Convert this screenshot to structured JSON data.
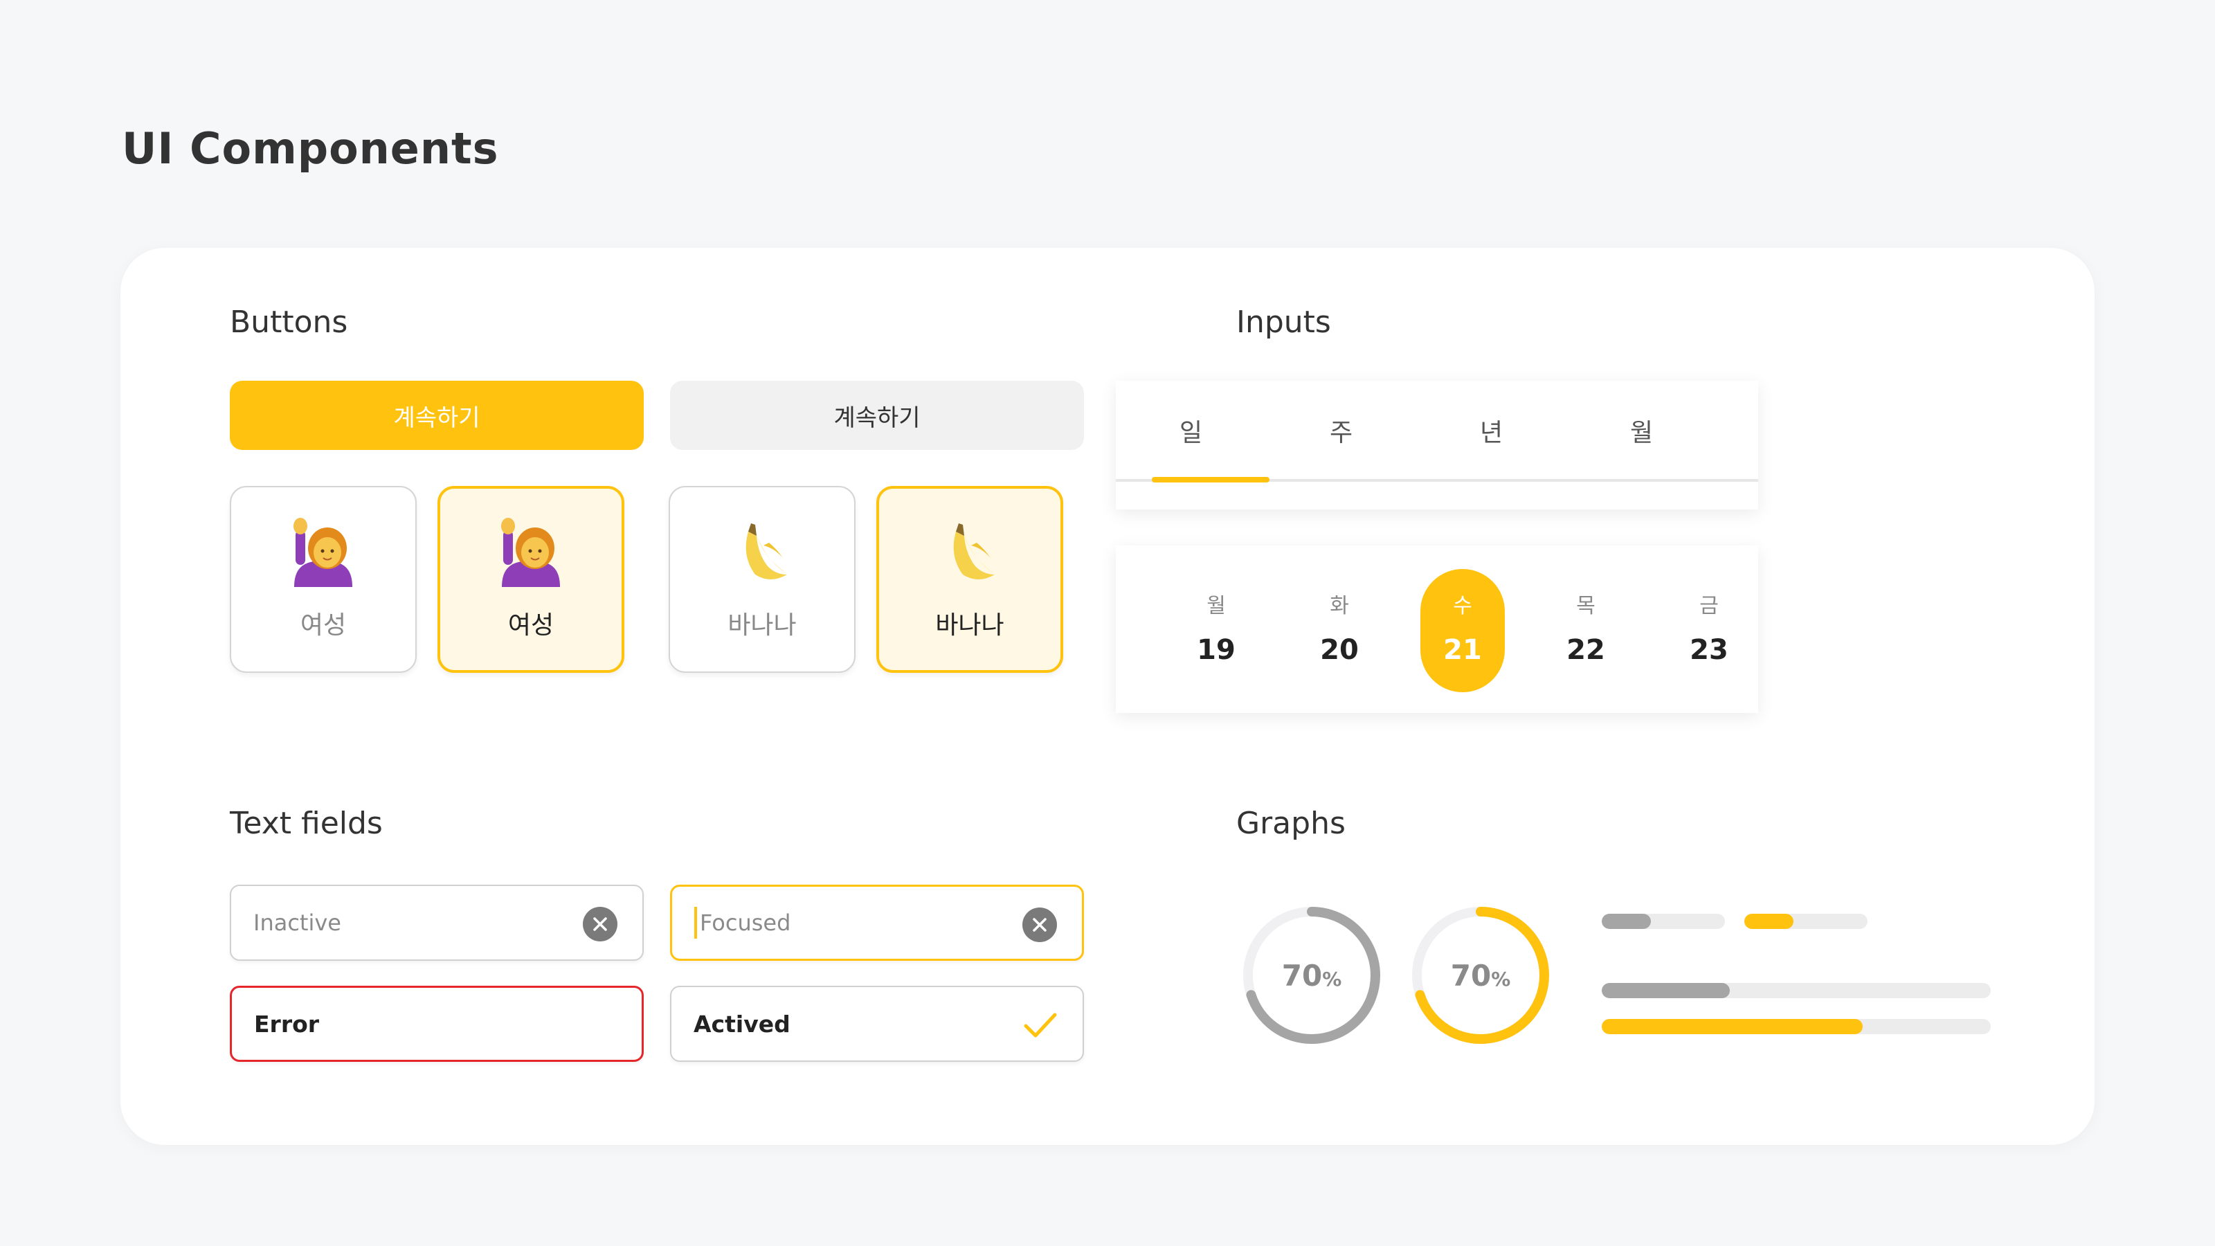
{
  "page": {
    "title": "UI Components"
  },
  "colors": {
    "accent": "#ffc20e",
    "gray": "#a5a5a5",
    "error": "#e5262b",
    "track": "#ececec"
  },
  "buttons": {
    "title": "Buttons",
    "primary_label": "계속하기",
    "secondary_label": "계속하기",
    "tiles": [
      {
        "icon": "woman-raising-hand-icon",
        "label": "여성",
        "selected": false
      },
      {
        "icon": "woman-raising-hand-icon",
        "label": "여성",
        "selected": true
      },
      {
        "icon": "banana-icon",
        "label": "바나나",
        "selected": false
      },
      {
        "icon": "banana-icon",
        "label": "바나나",
        "selected": true
      }
    ]
  },
  "inputs": {
    "title": "Inputs",
    "tabs": [
      {
        "label": "일",
        "active": true
      },
      {
        "label": "주",
        "active": false
      },
      {
        "label": "년",
        "active": false
      },
      {
        "label": "월",
        "active": false
      }
    ],
    "days": [
      {
        "dow": "월",
        "num": "19",
        "active": false
      },
      {
        "dow": "화",
        "num": "20",
        "active": false
      },
      {
        "dow": "수",
        "num": "21",
        "active": true
      },
      {
        "dow": "목",
        "num": "22",
        "active": false
      },
      {
        "dow": "금",
        "num": "23",
        "active": false
      }
    ]
  },
  "text_fields": {
    "title": "Text fields",
    "inactive_placeholder": "Inactive",
    "focused_placeholder": "Focused",
    "error_value": "Error",
    "actived_value": "Actived"
  },
  "graphs": {
    "title": "Graphs",
    "donuts": [
      {
        "value": "70",
        "unit": "%",
        "fraction": 0.7,
        "color": "gray"
      },
      {
        "value": "70",
        "unit": "%",
        "fraction": 0.7,
        "color": "accent"
      }
    ],
    "bars": [
      {
        "fraction": 0.4,
        "color": "gray"
      },
      {
        "fraction": 0.4,
        "color": "accent"
      },
      {
        "fraction": 0.33,
        "color": "gray"
      },
      {
        "fraction": 0.67,
        "color": "accent"
      }
    ]
  }
}
